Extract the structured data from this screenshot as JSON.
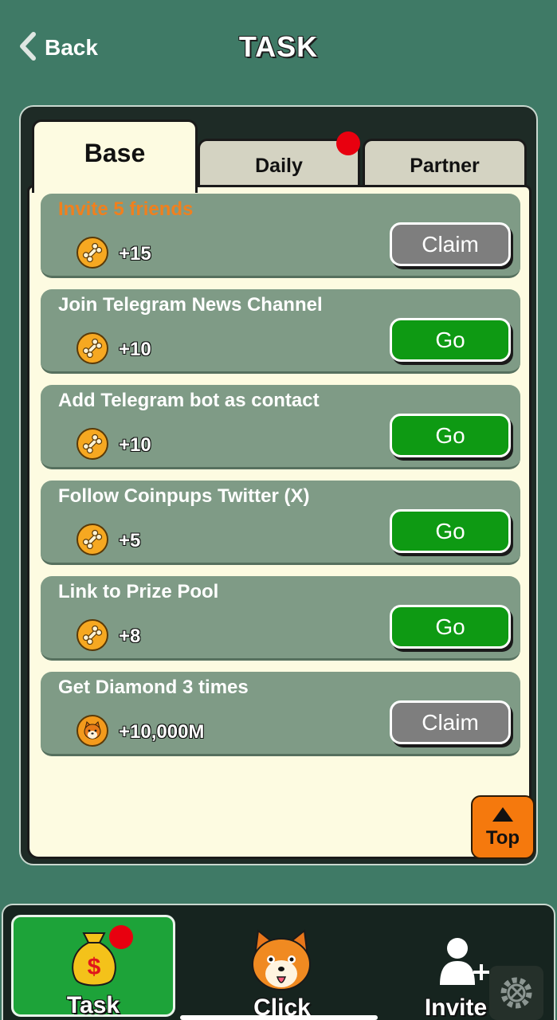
{
  "header": {
    "back_label": "Back",
    "title": "TASK"
  },
  "tabs": [
    {
      "label": "Base",
      "active": true
    },
    {
      "label": "Daily",
      "has_badge": true
    },
    {
      "label": "Partner"
    }
  ],
  "tasks": [
    {
      "title": "Invite 5 friends",
      "reward": "+15",
      "button": "Claim",
      "button_type": "claim",
      "icon": "bone-coin-icon",
      "highlight": true
    },
    {
      "title": "Join Telegram News Channel",
      "reward": "+10",
      "button": "Go",
      "button_type": "go",
      "icon": "bone-coin-icon"
    },
    {
      "title": "Add Telegram bot as contact",
      "reward": "+10",
      "button": "Go",
      "button_type": "go",
      "icon": "bone-coin-icon"
    },
    {
      "title": "Follow Coinpups Twitter (X)",
      "reward": "+5",
      "button": "Go",
      "button_type": "go",
      "icon": "bone-coin-icon"
    },
    {
      "title": "Link to Prize Pool",
      "reward": "+8",
      "button": "Go",
      "button_type": "go",
      "icon": "bone-coin-icon"
    },
    {
      "title": "Get Diamond 3 times",
      "reward": "+10,000M",
      "button": "Claim",
      "button_type": "claim",
      "icon": "shiba-coin-icon"
    }
  ],
  "top_button": {
    "label": "Top"
  },
  "bottom_nav": [
    {
      "label": "Task",
      "icon": "money-bag-icon",
      "active": true,
      "has_badge": true
    },
    {
      "label": "Click",
      "icon": "shiba-face-icon"
    },
    {
      "label": "Invite",
      "icon": "add-user-icon"
    }
  ],
  "colors": {
    "background": "#3f7a66",
    "card": "#7f9b86",
    "go_button": "#0e9a13",
    "claim_button": "#7e7e7e",
    "highlight_text": "#f0801e",
    "accent_orange": "#f5790d",
    "badge": "#e8000f"
  }
}
